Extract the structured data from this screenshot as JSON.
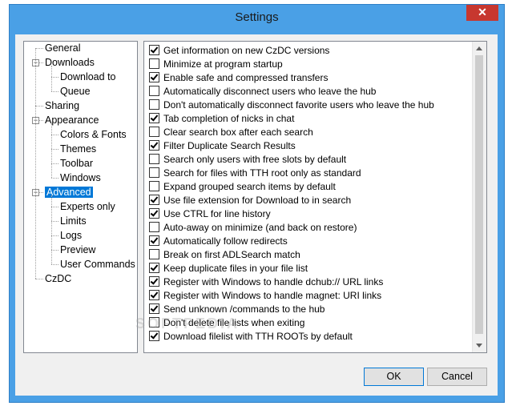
{
  "window": {
    "title": "Settings",
    "close_glyph": "✕"
  },
  "tree": {
    "items": [
      {
        "label": "General",
        "depth": 0,
        "expander": false
      },
      {
        "label": "Downloads",
        "depth": 0,
        "expander": true
      },
      {
        "label": "Download to",
        "depth": 1,
        "expander": false
      },
      {
        "label": "Queue",
        "depth": 1,
        "expander": false
      },
      {
        "label": "Sharing",
        "depth": 0,
        "expander": false
      },
      {
        "label": "Appearance",
        "depth": 0,
        "expander": true
      },
      {
        "label": "Colors & Fonts",
        "depth": 1,
        "expander": false
      },
      {
        "label": "Themes",
        "depth": 1,
        "expander": false
      },
      {
        "label": "Toolbar",
        "depth": 1,
        "expander": false
      },
      {
        "label": "Windows",
        "depth": 1,
        "expander": false
      },
      {
        "label": "Advanced",
        "depth": 0,
        "expander": true,
        "selected": true
      },
      {
        "label": "Experts only",
        "depth": 1,
        "expander": false
      },
      {
        "label": "Limits",
        "depth": 1,
        "expander": false
      },
      {
        "label": "Logs",
        "depth": 1,
        "expander": false
      },
      {
        "label": "Preview",
        "depth": 1,
        "expander": false
      },
      {
        "label": "User Commands",
        "depth": 1,
        "expander": false
      },
      {
        "label": "CzDC",
        "depth": 0,
        "expander": false
      }
    ]
  },
  "options": [
    {
      "label": "Get information on new CzDC versions",
      "checked": true
    },
    {
      "label": "Minimize at program startup",
      "checked": false
    },
    {
      "label": "Enable safe and compressed transfers",
      "checked": true
    },
    {
      "label": "Automatically disconnect users who leave the hub",
      "checked": false
    },
    {
      "label": "Don't automatically disconnect favorite users who leave the hub",
      "checked": false
    },
    {
      "label": "Tab completion of nicks in chat",
      "checked": true
    },
    {
      "label": "Clear search box after each search",
      "checked": false
    },
    {
      "label": "Filter Duplicate Search Results",
      "checked": true
    },
    {
      "label": "Search only users with free slots by default",
      "checked": false
    },
    {
      "label": "Search for files with TTH root only as standard",
      "checked": false
    },
    {
      "label": "Expand grouped search items by default",
      "checked": false
    },
    {
      "label": "Use file extension for Download to in search",
      "checked": true
    },
    {
      "label": "Use CTRL for line history",
      "checked": true
    },
    {
      "label": "Auto-away on minimize (and back on restore)",
      "checked": false
    },
    {
      "label": "Automatically follow redirects",
      "checked": true
    },
    {
      "label": "Break on first ADLSearch match",
      "checked": false
    },
    {
      "label": "Keep duplicate files in your file list",
      "checked": true
    },
    {
      "label": "Register with Windows to handle dchub:// URL links",
      "checked": true
    },
    {
      "label": "Register with Windows to handle magnet: URI links",
      "checked": true
    },
    {
      "label": "Send unknown /commands to the hub",
      "checked": true
    },
    {
      "label": "Don't delete file lists when exiting",
      "checked": false
    },
    {
      "label": "Download filelist with TTH ROOTs by default",
      "checked": true
    }
  ],
  "buttons": {
    "ok_label": "OK",
    "cancel_label": "Cancel"
  },
  "watermark": "SOFTPEDIA",
  "colors": {
    "frame": "#4aa0e6",
    "close": "#c7372f",
    "selection": "#0078d7"
  }
}
